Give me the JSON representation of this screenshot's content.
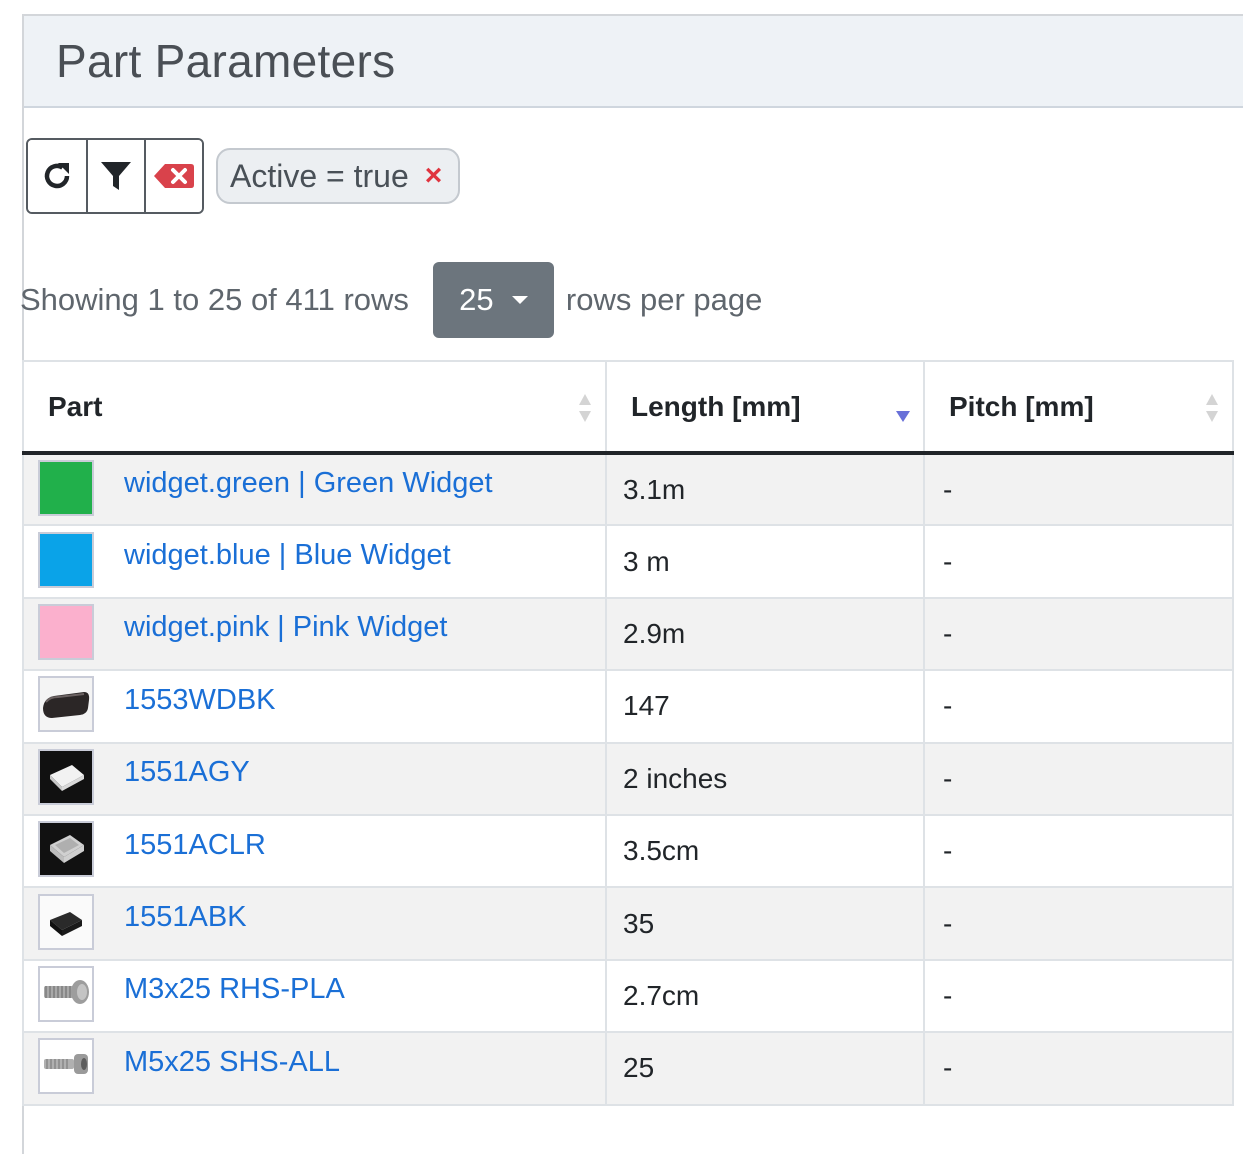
{
  "panel": {
    "title": "Part Parameters"
  },
  "toolbar": {
    "buttons": [
      "refresh-icon",
      "filter-icon",
      "clear-filters-icon"
    ],
    "filter_chip": {
      "label": "Active = true",
      "remove": "×"
    }
  },
  "pagination": {
    "showing": "Showing 1 to 25 of 411 rows",
    "page_size": "25",
    "per_page_label": "rows per page"
  },
  "table": {
    "headers": {
      "part": "Part",
      "length": "Length [mm]",
      "pitch": "Pitch [mm]"
    },
    "sort": {
      "column": "length",
      "direction": "desc",
      "active_color": "#6870d8"
    },
    "rows": [
      {
        "part": "widget.green | Green Widget",
        "length": "3.1m",
        "pitch": "-",
        "thumb": "swatch",
        "color": "#21b04b"
      },
      {
        "part": "widget.blue | Blue Widget",
        "length": "3 m",
        "pitch": "-",
        "thumb": "swatch",
        "color": "#0aa3e8"
      },
      {
        "part": "widget.pink | Pink Widget",
        "length": "2.9m",
        "pitch": "-",
        "thumb": "swatch",
        "color": "#fbb0cd"
      },
      {
        "part": "1553WDBK",
        "length": "147",
        "pitch": "-",
        "thumb": "enclosure-black-icon"
      },
      {
        "part": "1551AGY",
        "length": "2 inches",
        "pitch": "-",
        "thumb": "enclosure-grey-icon"
      },
      {
        "part": "1551ACLR",
        "length": "3.5cm",
        "pitch": "-",
        "thumb": "enclosure-clear-icon"
      },
      {
        "part": "1551ABK",
        "length": "35",
        "pitch": "-",
        "thumb": "enclosure-small-black-icon"
      },
      {
        "part": "M3x25 RHS-PLA",
        "length": "2.7cm",
        "pitch": "-",
        "thumb": "screw-button-head-icon"
      },
      {
        "part": "M5x25 SHS-ALL",
        "length": "25",
        "pitch": "-",
        "thumb": "screw-socket-head-icon"
      }
    ]
  }
}
